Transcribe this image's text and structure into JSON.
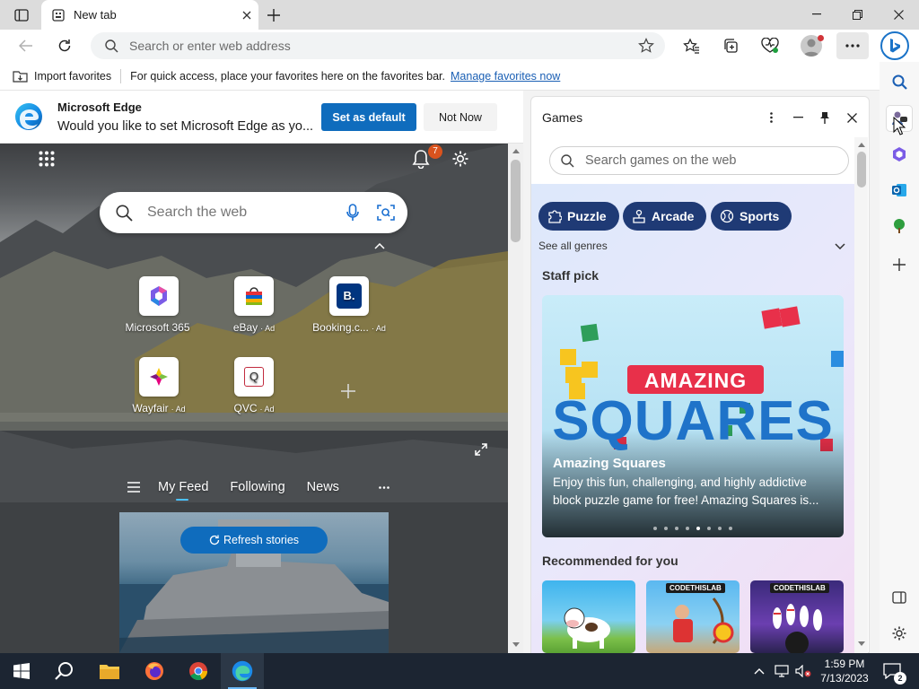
{
  "browser": {
    "tab_title": "New tab",
    "address_placeholder": "Search or enter web address"
  },
  "favorites_bar": {
    "import_label": "Import favorites",
    "message": "For quick access, place your favorites here on the favorites bar.",
    "manage_link": "Manage favorites now"
  },
  "banner": {
    "title": "Microsoft Edge",
    "message": "Would you like to set Microsoft Edge as yo...",
    "set_default_label": "Set as default",
    "not_now_label": "Not Now"
  },
  "ntp": {
    "notification_count": "7",
    "search_placeholder": "Search the web",
    "tiles": [
      {
        "label": "Microsoft 365",
        "ad": ""
      },
      {
        "label": "eBay",
        "ad": "· Ad"
      },
      {
        "label": "Booking.c...",
        "ad": "· Ad"
      },
      {
        "label": "Wayfair",
        "ad": "· Ad"
      },
      {
        "label": "QVC",
        "ad": "· Ad"
      }
    ],
    "feed_tabs": [
      "My Feed",
      "Following",
      "News"
    ],
    "refresh_label": "Refresh stories"
  },
  "games": {
    "panel_title": "Games",
    "search_placeholder": "Search games on the web",
    "genres": [
      "Puzzle",
      "Arcade",
      "Sports"
    ],
    "see_all": "See all genres",
    "staff_pick_heading": "Staff pick",
    "staff_pick": {
      "logo_top": "AMAZING",
      "logo_bottom": "SQUARES",
      "title": "Amazing Squares",
      "description": "Enjoy this fun, challenging, and highly addictive block puzzle game for free! Amazing Squares is...",
      "carousel_count": 8,
      "carousel_active": 4
    },
    "recommended_heading": "Recommended for you",
    "rec_badges": [
      "CODETHISLAB",
      "CODETHISLAB"
    ]
  },
  "taskbar": {
    "time": "1:59 PM",
    "date": "7/13/2023",
    "notification_count": "2"
  },
  "colors": {
    "accent": "#0f6cbd",
    "genre_pill": "#1f3a75",
    "taskbar": "#1c2532"
  }
}
